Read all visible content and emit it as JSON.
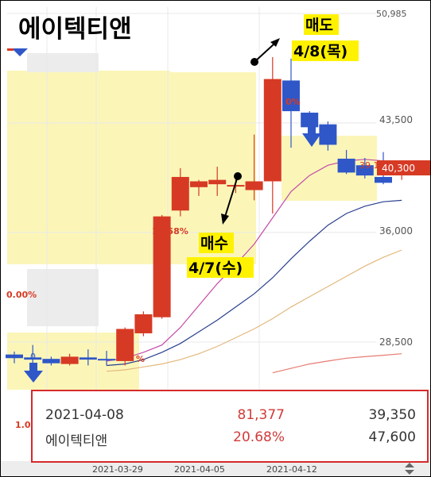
{
  "chart_data": {
    "type": "candlestick",
    "title": "에이텍티앤",
    "x_labels": [
      "2021-03-29",
      "2021-04-05",
      "2021-04-12"
    ],
    "y_ticks": [
      "50,985",
      "43,500",
      "36,000",
      "28,500"
    ],
    "y_tick_values": [
      50985,
      43500,
      36000,
      28500
    ],
    "ylim": [
      26500,
      51200
    ],
    "current_price_label": "40,300",
    "current_price": 40300,
    "candles": [
      {
        "o": 27650,
        "h": 27850,
        "l": 27050,
        "c": 27400
      },
      {
        "o": 27450,
        "h": 28300,
        "l": 26900,
        "c": 27300
      },
      {
        "o": 27350,
        "h": 27500,
        "l": 26900,
        "c": 27050
      },
      {
        "o": 27000,
        "h": 27700,
        "l": 26900,
        "c": 27500
      },
      {
        "o": 27450,
        "h": 28000,
        "l": 26900,
        "c": 27300
      },
      {
        "o": 27350,
        "h": 27900,
        "l": 26900,
        "c": 27250
      },
      {
        "o": 27200,
        "h": 29500,
        "l": 26900,
        "c": 29400
      },
      {
        "o": 29100,
        "h": 30600,
        "l": 28900,
        "c": 30400
      },
      {
        "o": 30200,
        "h": 37200,
        "l": 30100,
        "c": 37100
      },
      {
        "o": 37500,
        "h": 40400,
        "l": 37100,
        "c": 39800
      },
      {
        "o": 39100,
        "h": 39600,
        "l": 38500,
        "c": 39500
      },
      {
        "o": 39300,
        "h": 40500,
        "l": 38500,
        "c": 39600
      },
      {
        "o": 39250,
        "h": 39800,
        "l": 38700,
        "c": 39250
      },
      {
        "o": 38900,
        "h": 42700,
        "l": 38200,
        "c": 39500
      },
      {
        "o": 39500,
        "h": 48000,
        "l": 37300,
        "c": 46500
      },
      {
        "o": 46400,
        "h": 47900,
        "l": 41800,
        "c": 44300
      },
      {
        "o": 44200,
        "h": 44300,
        "l": 42700,
        "c": 43200
      },
      {
        "o": 43400,
        "h": 43600,
        "l": 41600,
        "c": 42000
      },
      {
        "o": 41050,
        "h": 41650,
        "l": 40000,
        "c": 40100
      },
      {
        "o": 40600,
        "h": 41100,
        "l": 39700,
        "c": 39900
      },
      {
        "o": 39800,
        "h": 41500,
        "l": 39300,
        "c": 39400
      },
      {
        "o": 40300,
        "h": 40900,
        "l": 39600,
        "c": 40300
      }
    ],
    "ma_lines": [
      {
        "color": "#c44aa8",
        "values": [
          null,
          null,
          null,
          null,
          null,
          27200,
          27400,
          27800,
          28300,
          29500,
          31000,
          32500,
          33800,
          35200,
          37000,
          38800,
          39900,
          40600,
          40900,
          41000,
          40900,
          40800
        ]
      },
      {
        "color": "#2a3f8f",
        "values": [
          null,
          null,
          null,
          null,
          null,
          26900,
          27000,
          27300,
          27800,
          28400,
          29200,
          30000,
          30900,
          31800,
          32900,
          34200,
          35400,
          36500,
          37300,
          37800,
          38100,
          38200
        ]
      },
      {
        "color": "#e3b87c",
        "values": [
          null,
          null,
          null,
          null,
          null,
          26500,
          26600,
          26800,
          27000,
          27300,
          27700,
          28200,
          28800,
          29400,
          30100,
          30900,
          31600,
          32300,
          33000,
          33700,
          34300,
          34800
        ]
      },
      {
        "color": "#e67b70",
        "values": [
          null,
          null,
          null,
          null,
          null,
          null,
          null,
          null,
          null,
          null,
          null,
          null,
          null,
          null,
          26400,
          26700,
          27000,
          27200,
          27400,
          27500,
          27600,
          27700
        ]
      }
    ]
  },
  "annotations": {
    "sell_label": "매도",
    "sell_date": "4/8(목)",
    "buy_label": "매수",
    "buy_date": "4/7(수)",
    "pct_a": "17.58%",
    "pct_b": "0.00%",
    "pct_c": "1.0",
    "pct_d": "0%",
    "pct_e": "%",
    "pct_f": "39.1",
    "marker_0": "0",
    "marker_2": "2"
  },
  "info_box": {
    "date": "2021-04-08",
    "volume": "81,377",
    "close": "39,350",
    "name": "에이텍티앤",
    "change_pct": "20.68%",
    "high": "47,600"
  },
  "colors": {
    "up": "#d63a24",
    "down": "#2f57c8",
    "highlight": "#fbf6b8"
  }
}
